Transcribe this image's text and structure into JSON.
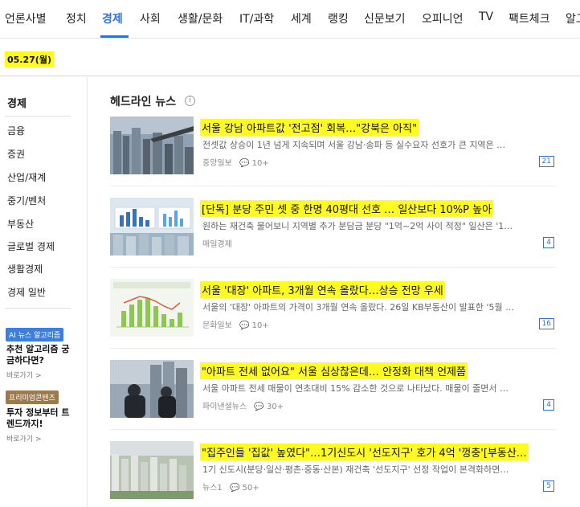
{
  "nav": {
    "tabs": [
      {
        "label": "언론사별"
      },
      {
        "label": "정치"
      },
      {
        "label": "경제"
      },
      {
        "label": "사회"
      },
      {
        "label": "생활/문화"
      },
      {
        "label": "IT/과학"
      },
      {
        "label": "세계"
      },
      {
        "label": "랭킹"
      },
      {
        "label": "신문보기"
      },
      {
        "label": "오피니언"
      },
      {
        "label": "TV"
      },
      {
        "label": "팩트체크"
      },
      {
        "label": "알고"
      }
    ],
    "active": "경제"
  },
  "date": "05.27(월)",
  "sidebar": {
    "title": "경제",
    "items": [
      {
        "label": "금융"
      },
      {
        "label": "증권"
      },
      {
        "label": "산업/재계"
      },
      {
        "label": "중기/벤처"
      },
      {
        "label": "부동산"
      },
      {
        "label": "글로벌 경제"
      },
      {
        "label": "생활경제"
      },
      {
        "label": "경제 일반"
      }
    ],
    "promos": [
      {
        "badge": "AI 뉴스 알고리즘",
        "text": "추천 알고리즘 궁금하다면?",
        "more": "바로가기 >"
      },
      {
        "badge": "프리미엄콘텐츠",
        "text": "투자 정보부터 트렌드까지!",
        "more": "바로가기 >"
      }
    ]
  },
  "headline": {
    "title": "헤드라인 뉴스",
    "info_icon": "i",
    "articles": [
      {
        "title": "서울 강남 아파트값 '전고점' 회복…\"강북은 아직\"",
        "summary": "전셋값 상승이 1년 넘게 지속되며 서울 강남·송파 등 실수요자 선호가 큰 지역은 …",
        "press": "중앙일보",
        "comments": "10+",
        "count": "21"
      },
      {
        "title": "[단독] 분당 주민 셋 중 한명 40평대 선호 … 일산보다 10%P 높아",
        "summary": "원하는 재건축 물어보니 지역별 추가 분담금 분당 \"1억~2억 사이 적정\" 일산은 '1…",
        "press": "매일경제",
        "comments": "",
        "count": "4"
      },
      {
        "title": "서울 '대장' 아파트, 3개월 연속 올랐다…상승 전망 우세",
        "summary": "서울의 '대장' 아파트의 가격이 3개월 연속 올랐다. 26일 KB부동산이 발표한 '5월 …",
        "press": "문화일보",
        "comments": "10+",
        "count": "16"
      },
      {
        "title": "\"아파트 전세 없어요\" 서울 심상찮은데… 안정화 대책 언제쯤",
        "summary": "서울 아파트 전세 매물이 연초대비 15% 감소한 것으로 나타났다. 매물이 줄면서 …",
        "press": "파이낸셜뉴스",
        "comments": "30+",
        "count": "4"
      },
      {
        "title": "\"집주인들 '집값' 높였다\"…1기신도시 '선도지구' 호가 4억 '껑충'[부동산…",
        "summary": "1기 신도시(분당·일산·평촌·중동·산본) 재건축 '선도지구' 선정 작업이 본격화하면…",
        "press": "뉴스1",
        "comments": "50+",
        "count": "5"
      }
    ]
  },
  "colors": {
    "accent": "#2f6fde",
    "highlight": "#fffb21"
  }
}
